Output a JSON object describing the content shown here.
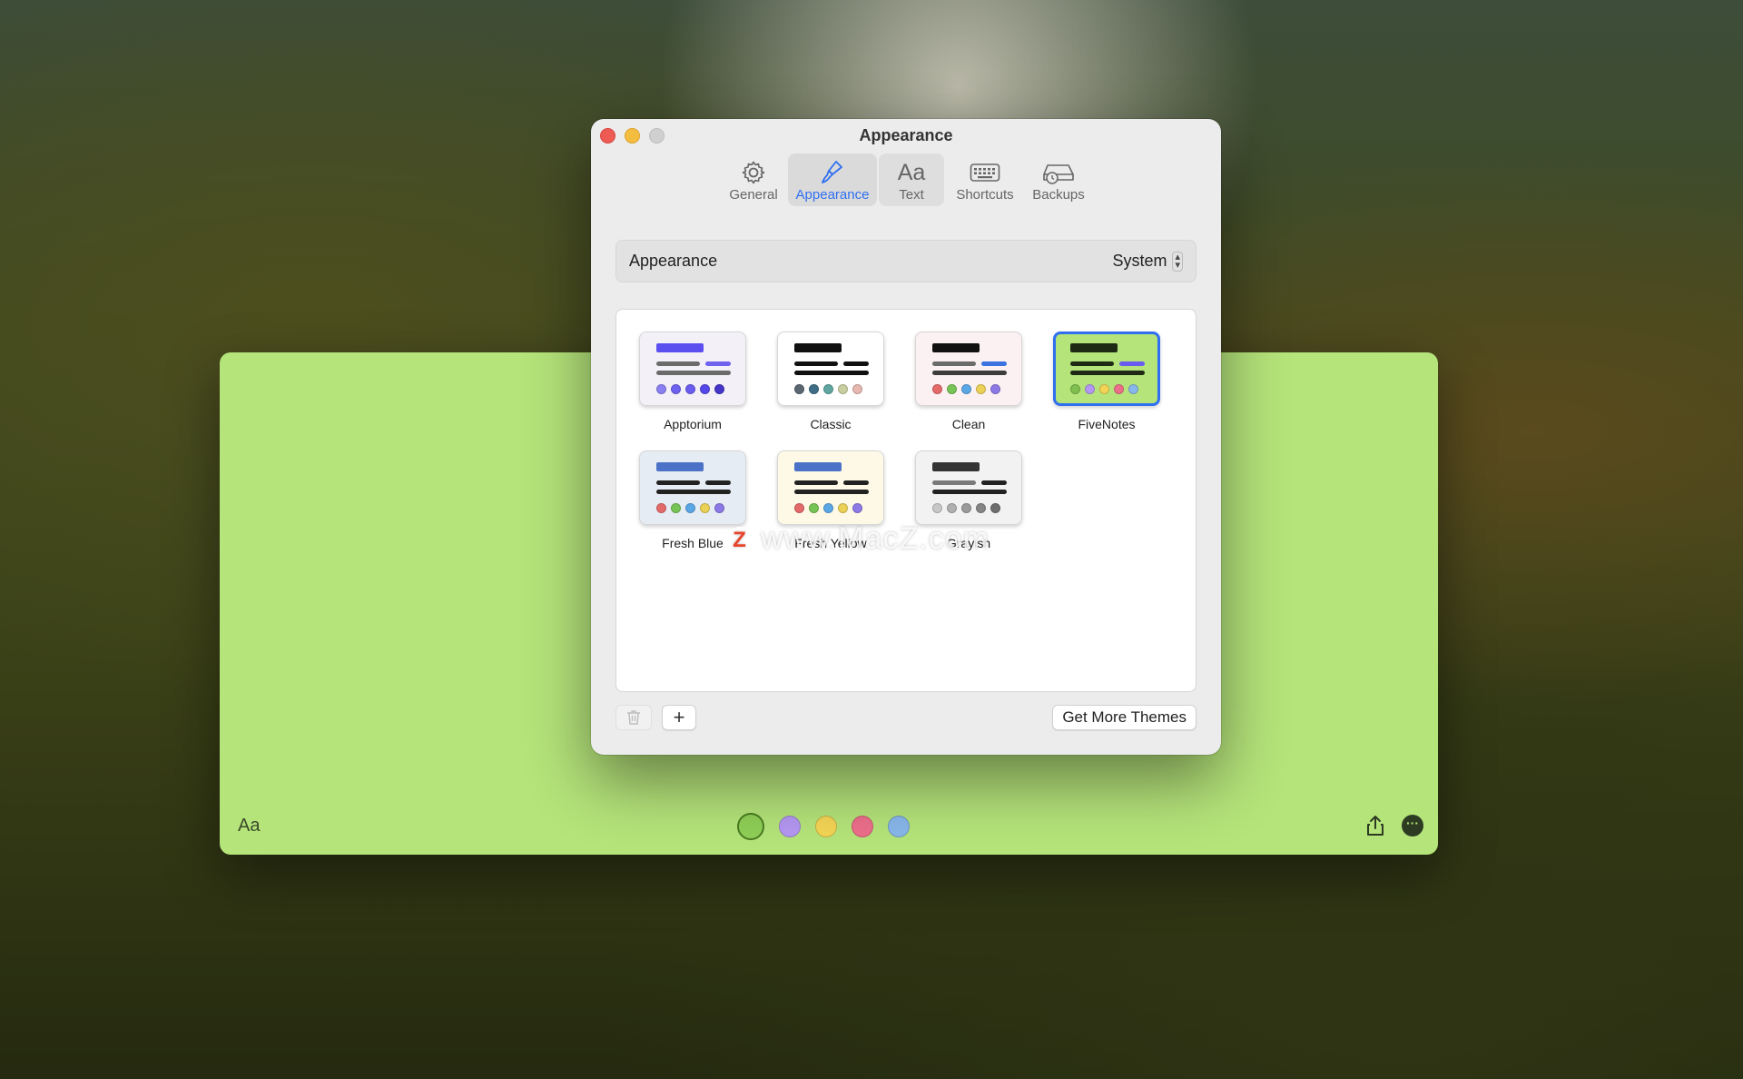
{
  "note": {
    "font_button": "Aa",
    "colors": [
      "#8fcf57",
      "#b497f2",
      "#f3d555",
      "#ec6f8a",
      "#88b7ea"
    ],
    "selected_color": 0
  },
  "window": {
    "title": "Appearance"
  },
  "toolbar": {
    "general": "General",
    "appearance": "Appearance",
    "text_glyph": "Aa",
    "text": "Text",
    "shortcuts": "Shortcuts",
    "backups": "Backups"
  },
  "appearance_setting": {
    "label": "Appearance",
    "value": "System"
  },
  "themes": [
    {
      "name": "Apptorium",
      "bg": "#f3f1f7",
      "title": "#5b4ff0",
      "lines": [
        "#6b6b6b",
        "#6f62ef",
        "#6b6b6b"
      ],
      "dots": [
        "#8a7ff3",
        "#6f61f0",
        "#6a5cef",
        "#5548ea",
        "#4435c8"
      ],
      "selected": false
    },
    {
      "name": "Classic",
      "bg": "#ffffff",
      "title": "#111111",
      "lines": [
        "#111111",
        "#111111",
        "#111111"
      ],
      "dots": [
        "#5a6670",
        "#3e6e86",
        "#5fa6a0",
        "#c9cfa0",
        "#e6b8b0"
      ],
      "selected": false
    },
    {
      "name": "Clean",
      "bg": "#fbf0f2",
      "title": "#111111",
      "lines": [
        "#6b6b6b",
        "#3b74e0",
        "#3c3c3c"
      ],
      "dots": [
        "#e46a6a",
        "#77c456",
        "#5aa7e6",
        "#ecd157",
        "#8d79e6"
      ],
      "selected": false
    },
    {
      "name": "FiveNotes",
      "bg": "#b5e47a",
      "title": "#1f2a14",
      "lines": [
        "#1f2a14",
        "#6a5cef",
        "#1f2a14"
      ],
      "dots": [
        "#7fbf4f",
        "#b497f2",
        "#f3d555",
        "#ec6f8a",
        "#88b7ea"
      ],
      "selected": true
    },
    {
      "name": "Fresh Blue",
      "bg": "#e6ecf3",
      "title": "#4b72c6",
      "lines": [
        "#222222",
        "#222222",
        "#222222"
      ],
      "dots": [
        "#e46a6a",
        "#77c456",
        "#5aa7e6",
        "#ecd157",
        "#8d79e6"
      ],
      "selected": false
    },
    {
      "name": "Fresh Yellow",
      "bg": "#fdf9e6",
      "title": "#4b72c6",
      "lines": [
        "#222222",
        "#222222",
        "#222222"
      ],
      "dots": [
        "#e46a6a",
        "#77c456",
        "#5aa7e6",
        "#ecd157",
        "#8d79e6"
      ],
      "selected": false
    },
    {
      "name": "Grayish",
      "bg": "#f2f2f2",
      "title": "#333333",
      "lines": [
        "#7a7a7a",
        "#222222",
        "#222222"
      ],
      "dots": [
        "#c8c8c8",
        "#b0b0b0",
        "#9a9a9a",
        "#858585",
        "#6e6e6e"
      ],
      "selected": false
    }
  ],
  "buttons": {
    "add": "+",
    "get_more": "Get More Themes"
  },
  "watermark": {
    "logo": "Z",
    "text": "www.MacZ.com"
  }
}
